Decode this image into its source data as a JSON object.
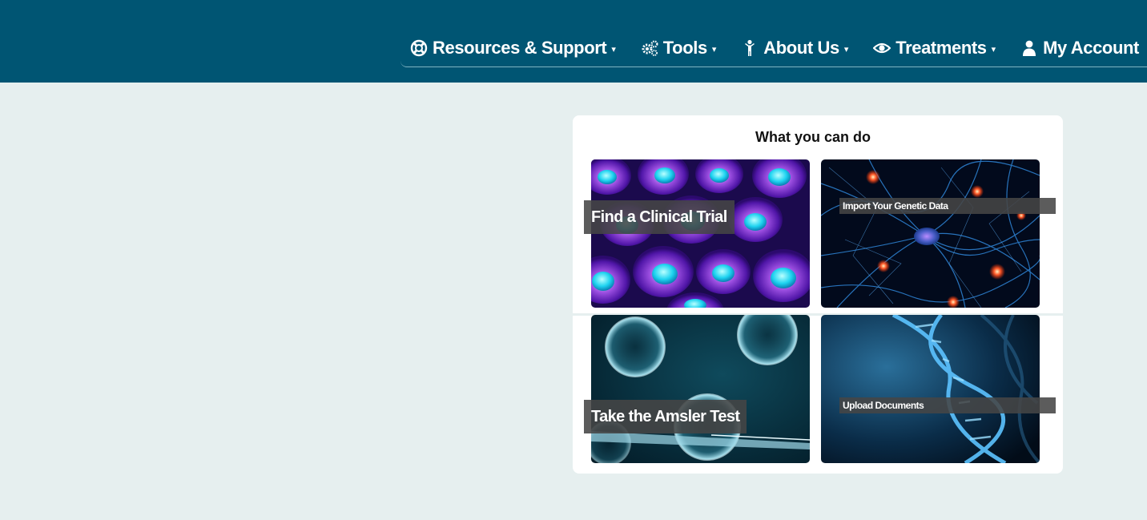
{
  "nav": {
    "items": [
      {
        "label": "Resources & Support",
        "icon": "lifebuoy-icon"
      },
      {
        "label": "Tools",
        "icon": "gears-icon"
      },
      {
        "label": "About Us",
        "icon": "person-icon"
      },
      {
        "label": "Treatments",
        "icon": "eye-icon"
      },
      {
        "label": "My Account",
        "icon": "user-icon"
      }
    ],
    "caret": "▾"
  },
  "card": {
    "title": "What you can do",
    "tiles": [
      {
        "label": "Find a Clinical Trial",
        "image": "purple cells"
      },
      {
        "label": "Import Your Genetic Data",
        "image": "blue neurons"
      },
      {
        "label": "Take the Amsler Test",
        "image": "cell injection"
      },
      {
        "label": "Upload Documents",
        "image": "dna helix"
      }
    ]
  },
  "colors": {
    "header": "#005573",
    "background": "#e6efef",
    "card": "#ffffff",
    "label_bg": "#464646"
  }
}
